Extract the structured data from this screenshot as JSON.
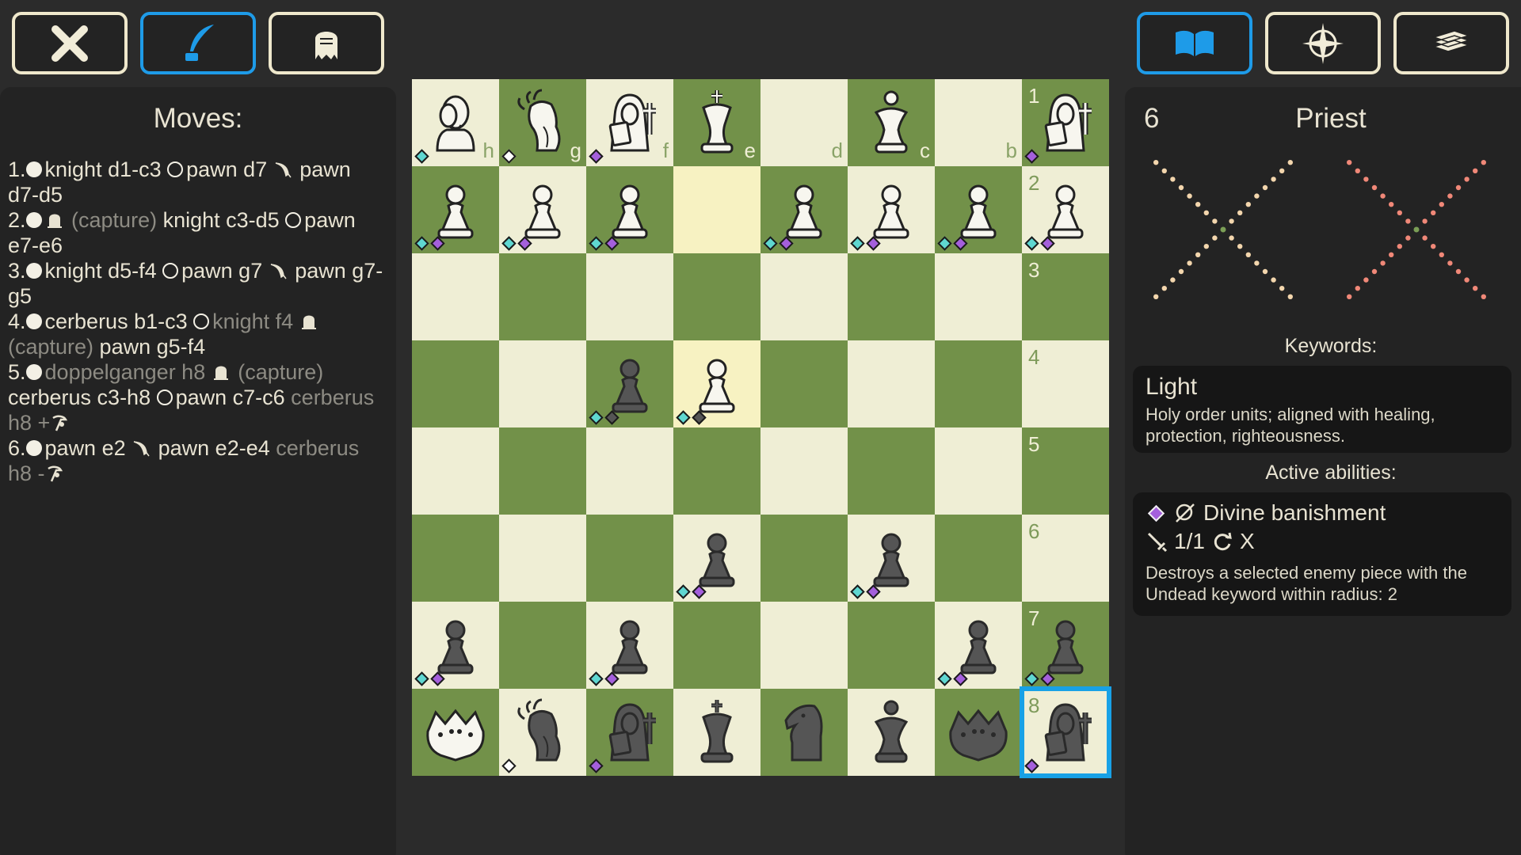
{
  "toolbar_left": [
    {
      "name": "close-button",
      "icon": "close-icon",
      "active": false
    },
    {
      "name": "quill-button",
      "icon": "quill-icon",
      "active": true
    },
    {
      "name": "ghost-button",
      "icon": "ghost-icon",
      "active": false
    }
  ],
  "toolbar_right": [
    {
      "name": "rulebook-button",
      "icon": "open-book-icon",
      "active": true
    },
    {
      "name": "compass-button",
      "icon": "compass-star-icon",
      "active": false
    },
    {
      "name": "cards-button",
      "icon": "card-stack-icon",
      "active": false
    }
  ],
  "moves": {
    "title": "Moves:",
    "list": [
      [
        {
          "t": "1."
        },
        {
          "i": "white-dot"
        },
        {
          "t": "knight d1-c3 "
        },
        {
          "i": "hollow-dot"
        },
        {
          "t": "pawn d7 "
        },
        {
          "i": "wing-icon"
        },
        {
          "t": " pawn d7-d5"
        }
      ],
      [
        {
          "t": "2."
        },
        {
          "i": "white-dot"
        },
        {
          "i": "tombstone-icon"
        },
        {
          "t": " (capture)",
          "dim": true
        },
        {
          "t": " knight c3-d5 "
        },
        {
          "i": "hollow-dot"
        },
        {
          "t": "pawn e7-e6"
        }
      ],
      [
        {
          "t": "3."
        },
        {
          "i": "white-dot"
        },
        {
          "t": "knight d5-f4 "
        },
        {
          "i": "hollow-dot"
        },
        {
          "t": "pawn g7 "
        },
        {
          "i": "wing-icon"
        },
        {
          "t": " pawn g7-g5"
        }
      ],
      [
        {
          "t": "4."
        },
        {
          "i": "white-dot"
        },
        {
          "t": "cerberus b1-c3 "
        },
        {
          "i": "hollow-dot"
        },
        {
          "t": "knight f4 ",
          "dim": true
        },
        {
          "i": "tombstone-icon"
        },
        {
          "t": " (capture)",
          "dim": true
        },
        {
          "t": " pawn g5-f4"
        }
      ],
      [
        {
          "t": "5."
        },
        {
          "i": "white-dot"
        },
        {
          "t": "doppelganger h8 ",
          "dim": true
        },
        {
          "i": "tombstone-icon"
        },
        {
          "t": " (capture)",
          "dim": true
        },
        {
          "t": " cerberus c3-h8 "
        },
        {
          "i": "hollow-dot"
        },
        {
          "t": "pawn c7-c6 "
        },
        {
          "t": "cerberus h8 +",
          "dim": true
        },
        {
          "i": "reaper-icon"
        }
      ],
      [
        {
          "t": "6."
        },
        {
          "i": "white-dot"
        },
        {
          "t": "pawn e2 "
        },
        {
          "i": "wing-icon"
        },
        {
          "t": " pawn e2-e4 "
        },
        {
          "t": "cerberus h8 -",
          "dim": true
        },
        {
          "i": "reaper-icon"
        }
      ]
    ]
  },
  "board": {
    "files_bottom_row": [
      "h",
      "g",
      "f",
      "e",
      "d",
      "c",
      "b",
      ""
    ],
    "ranks": [
      "1",
      "2",
      "3",
      "4",
      "5",
      "6",
      "7",
      "8"
    ],
    "rows": [
      [
        {
          "p": "doppelganger",
          "c": "white",
          "m": [
            "cy"
          ]
        },
        {
          "p": "druid",
          "c": "white",
          "m": [
            "wh"
          ]
        },
        {
          "p": "priest",
          "c": "white",
          "m": [
            "pu"
          ]
        },
        {
          "p": "king",
          "c": "white",
          "m": []
        },
        {
          "p": "",
          "m": []
        },
        {
          "p": "queen",
          "c": "white",
          "m": []
        },
        {
          "p": "",
          "m": []
        },
        {
          "p": "priest",
          "c": "white",
          "m": [
            "pu"
          ]
        }
      ],
      [
        {
          "p": "pawn",
          "c": "white",
          "m": [
            "cy",
            "pu"
          ]
        },
        {
          "p": "pawn",
          "c": "white",
          "m": [
            "cy",
            "pu"
          ]
        },
        {
          "p": "pawn",
          "c": "white",
          "m": [
            "cy",
            "pu"
          ]
        },
        {
          "p": "",
          "m": [],
          "hl": true
        },
        {
          "p": "pawn",
          "c": "white",
          "m": [
            "cy",
            "pu"
          ]
        },
        {
          "p": "pawn",
          "c": "white",
          "m": [
            "cy",
            "pu"
          ]
        },
        {
          "p": "pawn",
          "c": "white",
          "m": [
            "cy",
            "pu"
          ]
        },
        {
          "p": "pawn",
          "c": "white",
          "m": [
            "cy",
            "pu"
          ]
        }
      ],
      [
        {
          "p": "",
          "m": []
        },
        {
          "p": "",
          "m": []
        },
        {
          "p": "",
          "m": []
        },
        {
          "p": "",
          "m": []
        },
        {
          "p": "",
          "m": []
        },
        {
          "p": "",
          "m": []
        },
        {
          "p": "",
          "m": []
        },
        {
          "p": "",
          "m": []
        }
      ],
      [
        {
          "p": "",
          "m": []
        },
        {
          "p": "",
          "m": []
        },
        {
          "p": "pawn",
          "c": "black",
          "m": [
            "cy",
            "gr"
          ]
        },
        {
          "p": "pawn",
          "c": "white",
          "m": [
            "cy",
            "gr"
          ],
          "hl": true
        },
        {
          "p": "",
          "m": []
        },
        {
          "p": "",
          "m": []
        },
        {
          "p": "",
          "m": []
        },
        {
          "p": "",
          "m": []
        }
      ],
      [
        {
          "p": "",
          "m": []
        },
        {
          "p": "",
          "m": []
        },
        {
          "p": "",
          "m": []
        },
        {
          "p": "",
          "m": []
        },
        {
          "p": "",
          "m": []
        },
        {
          "p": "",
          "m": []
        },
        {
          "p": "",
          "m": []
        },
        {
          "p": "",
          "m": []
        }
      ],
      [
        {
          "p": "",
          "m": []
        },
        {
          "p": "",
          "m": []
        },
        {
          "p": "",
          "m": []
        },
        {
          "p": "pawn",
          "c": "black",
          "m": [
            "cy",
            "pu"
          ]
        },
        {
          "p": "",
          "m": []
        },
        {
          "p": "pawn",
          "c": "black",
          "m": [
            "cy",
            "pu"
          ]
        },
        {
          "p": "",
          "m": []
        },
        {
          "p": "",
          "m": []
        }
      ],
      [
        {
          "p": "pawn",
          "c": "black",
          "m": [
            "cy",
            "pu"
          ]
        },
        {
          "p": "",
          "m": []
        },
        {
          "p": "pawn",
          "c": "black",
          "m": [
            "cy",
            "pu"
          ]
        },
        {
          "p": "",
          "m": []
        },
        {
          "p": "",
          "m": []
        },
        {
          "p": "",
          "m": []
        },
        {
          "p": "pawn",
          "c": "black",
          "m": [
            "cy",
            "pu"
          ]
        },
        {
          "p": "pawn",
          "c": "black",
          "m": [
            "cy",
            "pu"
          ]
        }
      ],
      [
        {
          "p": "cerberus",
          "c": "white",
          "m": []
        },
        {
          "p": "druid",
          "c": "black",
          "m": [
            "wh"
          ]
        },
        {
          "p": "priest",
          "c": "black",
          "m": [
            "pu"
          ]
        },
        {
          "p": "king",
          "c": "black",
          "m": []
        },
        {
          "p": "knight",
          "c": "black",
          "m": []
        },
        {
          "p": "queen",
          "c": "black",
          "m": []
        },
        {
          "p": "cerberus",
          "c": "black",
          "m": []
        },
        {
          "p": "priest",
          "c": "black",
          "m": [
            "pu"
          ],
          "sel": true
        }
      ]
    ]
  },
  "info": {
    "number": "6",
    "name": "Priest",
    "pattern_colors": {
      "left": "#f3d6ad",
      "right": "#f08878",
      "center_left": "#7b9e56",
      "center_right": "#7b9e56"
    },
    "keywords_title": "Keywords:",
    "keyword": {
      "title": "Light",
      "text": "Holy order units; aligned with healing, protection, righteousness."
    },
    "abilities_title": "Active abilities:",
    "ability": {
      "name": "Divine banishment",
      "charges": "1/1",
      "cooldown": "X",
      "text": "Destroys a selected enemy piece with the Undead keyword within radius: 2"
    }
  }
}
